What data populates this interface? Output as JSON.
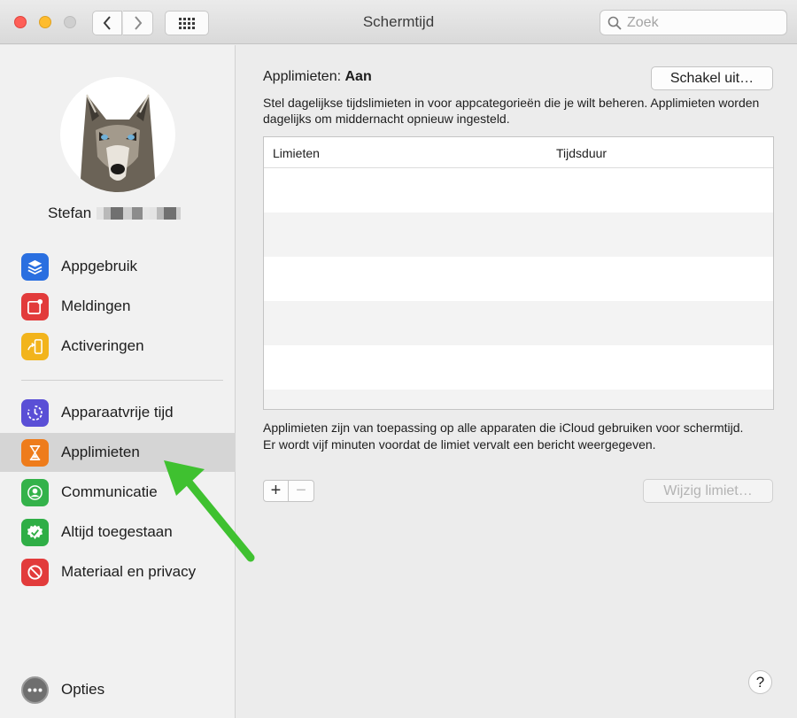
{
  "window": {
    "title": "Schermtijd"
  },
  "search": {
    "placeholder": "Zoek"
  },
  "user": {
    "name": "Stefan"
  },
  "sidebar": {
    "items": [
      {
        "label": "Appgebruik",
        "icon": "layers-icon",
        "color": "#2a6fe0"
      },
      {
        "label": "Meldingen",
        "icon": "notification-icon",
        "color": "#e23b3b"
      },
      {
        "label": "Activeringen",
        "icon": "pickup-icon",
        "color": "#f2b41c"
      },
      {
        "label": "Apparaatvrije tijd",
        "icon": "downtime-icon",
        "color": "#5a4fd6"
      },
      {
        "label": "Applimieten",
        "icon": "hourglass-icon",
        "color": "#ee7c1b"
      },
      {
        "label": "Communicatie",
        "icon": "contact-icon",
        "color": "#34b24a"
      },
      {
        "label": "Altijd toegestaan",
        "icon": "checkmark-icon",
        "color": "#2fae46"
      },
      {
        "label": "Materiaal en privacy",
        "icon": "restriction-icon",
        "color": "#e23b3b"
      }
    ],
    "options_label": "Opties"
  },
  "main": {
    "heading_prefix": "Applimieten:",
    "heading_status": "Aan",
    "disable_button": "Schakel uit…",
    "description": "Stel dagelijkse tijdslimieten in voor appcategorieën die je wilt beheren. Applimieten worden dagelijks om middernacht opnieuw ingesteld.",
    "table": {
      "columns": [
        "Limieten",
        "Tijdsduur"
      ]
    },
    "note": "Applimieten zijn van toepassing op alle apparaten die iCloud gebruiken voor schermtijd. Er wordt vijf minuten voordat de limiet vervalt een bericht weergegeven.",
    "add_symbol": "+",
    "remove_symbol": "−",
    "edit_button": "Wijzig limiet…",
    "help_symbol": "?"
  },
  "colors": {
    "selected_bg": "#d5d5d5",
    "arrow": "#3fc130"
  }
}
